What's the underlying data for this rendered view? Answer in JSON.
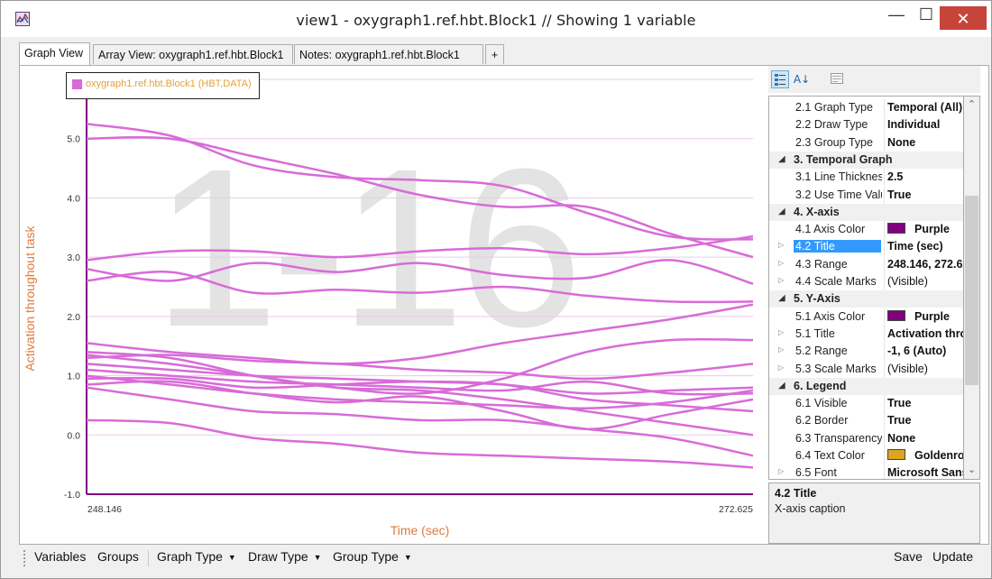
{
  "window": {
    "title": "view1 - oxygraph1.ref.hbt.Block1 // Showing 1 variable",
    "minimize_glyph": "—",
    "maximize_glyph": "☐",
    "close_glyph": "✕"
  },
  "tabs": [
    {
      "label": "Graph View",
      "active": true
    },
    {
      "label": "Array View: oxygraph1.ref.hbt.Block1",
      "active": false
    },
    {
      "label": "Notes: oxygraph1.ref.hbt.Block1",
      "active": false
    },
    {
      "label": "+",
      "active": false
    }
  ],
  "watermark": "1-16",
  "legend": {
    "label": "oxygraph1.ref.hbt.Block1 (HBT,DATA)",
    "swatch_color": "#d86bd8",
    "text_color": "#e3a23a"
  },
  "chart_data": {
    "type": "line",
    "xlabel": "Time (sec)",
    "ylabel": "Activation throughout task",
    "xlim": [
      248.146,
      272.625
    ],
    "ylim": [
      -1.0,
      6.0
    ],
    "x_tick_labels": [
      "248.146",
      "272.625"
    ],
    "y_ticks": [
      "-1.0",
      "0.0",
      "1.0",
      "2.0",
      "3.0",
      "4.0",
      "5.0",
      "6.0"
    ],
    "line_color": "#d86bd8",
    "axis_color": "#800080",
    "label_color": "#e07a3a",
    "grid": true,
    "x": [
      248.146,
      251.206,
      254.266,
      257.326,
      260.386,
      263.446,
      266.506,
      269.566,
      272.625
    ],
    "series": [
      {
        "values": [
          5.25,
          5.05,
          4.55,
          4.35,
          4.3,
          4.2,
          3.75,
          3.35,
          3.3
        ]
      },
      {
        "values": [
          5.0,
          5.0,
          4.7,
          4.4,
          4.05,
          3.85,
          3.85,
          3.4,
          3.0
        ]
      },
      {
        "values": [
          2.95,
          3.1,
          3.1,
          3.0,
          3.1,
          3.15,
          3.05,
          3.15,
          3.35
        ]
      },
      {
        "values": [
          2.8,
          2.6,
          2.9,
          2.75,
          2.9,
          2.7,
          2.65,
          2.95,
          2.55
        ]
      },
      {
        "values": [
          2.6,
          2.75,
          2.4,
          2.45,
          2.4,
          2.5,
          2.35,
          2.25,
          2.25
        ]
      },
      {
        "values": [
          1.55,
          1.4,
          1.3,
          1.2,
          1.3,
          1.55,
          1.75,
          1.95,
          2.2
        ]
      },
      {
        "values": [
          1.35,
          1.2,
          1.0,
          0.8,
          0.7,
          0.95,
          1.4,
          1.6,
          1.6
        ]
      },
      {
        "values": [
          1.3,
          1.35,
          1.25,
          1.2,
          1.1,
          1.05,
          0.95,
          1.05,
          1.2
        ]
      },
      {
        "values": [
          1.2,
          1.1,
          1.0,
          0.95,
          0.9,
          0.85,
          0.7,
          0.75,
          0.8
        ]
      },
      {
        "values": [
          1.1,
          1.0,
          0.9,
          0.85,
          0.8,
          0.75,
          0.9,
          0.7,
          0.7
        ]
      },
      {
        "values": [
          0.95,
          0.95,
          0.8,
          0.85,
          0.9,
          0.85,
          0.6,
          0.5,
          0.4
        ]
      },
      {
        "values": [
          1.4,
          1.3,
          1.0,
          0.8,
          0.75,
          0.6,
          0.4,
          0.2,
          0.0
        ]
      },
      {
        "values": [
          0.85,
          0.9,
          0.7,
          0.55,
          0.65,
          0.4,
          0.1,
          0.35,
          0.6
        ]
      },
      {
        "values": [
          0.8,
          0.6,
          0.4,
          0.35,
          0.25,
          0.25,
          0.1,
          -0.05,
          -0.35
        ]
      },
      {
        "values": [
          0.25,
          0.2,
          -0.05,
          -0.15,
          -0.3,
          -0.35,
          -0.4,
          -0.45,
          -0.55
        ]
      },
      {
        "values": [
          1.0,
          0.85,
          0.7,
          0.6,
          0.55,
          0.5,
          0.45,
          0.55,
          0.75
        ]
      }
    ]
  },
  "property_grid": {
    "toolbar_icons": [
      "categorized-icon",
      "alphabetical-icon",
      "property-pages-icon"
    ],
    "alpha_label": "A↓",
    "rows": [
      {
        "kind": "prop",
        "expand": "",
        "name": "2.1 Graph Type",
        "value": "Temporal (All)",
        "bold": true
      },
      {
        "kind": "prop",
        "expand": "",
        "name": "2.2 Draw Type",
        "value": "Individual",
        "bold": true
      },
      {
        "kind": "prop",
        "expand": "",
        "name": "2.3 Group Type",
        "value": "None",
        "bold": true
      },
      {
        "kind": "cat",
        "name": "3. Temporal Graph"
      },
      {
        "kind": "prop",
        "expand": "",
        "name": "3.1 Line Thickness",
        "value": "2.5",
        "bold": true
      },
      {
        "kind": "prop",
        "expand": "",
        "name": "3.2 Use Time Values",
        "value": "True",
        "bold": true
      },
      {
        "kind": "cat",
        "name": "4. X-axis"
      },
      {
        "kind": "prop",
        "expand": "",
        "name": "4.1 Axis Color",
        "value": "Purple",
        "bold": true,
        "swatch": "#800080"
      },
      {
        "kind": "prop",
        "expand": "▷",
        "name": "4.2 Title",
        "value": "Time (sec)",
        "bold": true,
        "selected": true
      },
      {
        "kind": "prop",
        "expand": "▷",
        "name": "4.3 Range",
        "value": "248.146, 272.625",
        "bold": true
      },
      {
        "kind": "prop",
        "expand": "▷",
        "name": "4.4 Scale Marks",
        "value": "(Visible)",
        "bold": false
      },
      {
        "kind": "cat",
        "name": "5. Y-Axis"
      },
      {
        "kind": "prop",
        "expand": "",
        "name": "5.1 Axis Color",
        "value": "Purple",
        "bold": true,
        "swatch": "#800080"
      },
      {
        "kind": "prop",
        "expand": "▷",
        "name": "5.1 Title",
        "value": "Activation throughout task",
        "bold": true
      },
      {
        "kind": "prop",
        "expand": "▷",
        "name": "5.2 Range",
        "value": "-1, 6 (Auto)",
        "bold": true
      },
      {
        "kind": "prop",
        "expand": "▷",
        "name": "5.3 Scale Marks",
        "value": "(Visible)",
        "bold": false
      },
      {
        "kind": "cat",
        "name": "6. Legend"
      },
      {
        "kind": "prop",
        "expand": "",
        "name": "6.1 Visible",
        "value": "True",
        "bold": true
      },
      {
        "kind": "prop",
        "expand": "",
        "name": "6.2 Border",
        "value": "True",
        "bold": true
      },
      {
        "kind": "prop",
        "expand": "",
        "name": "6.3 Transparency",
        "value": "None",
        "bold": true
      },
      {
        "kind": "prop",
        "expand": "",
        "name": "6.4 Text Color",
        "value": "Goldenrod",
        "bold": true,
        "swatch": "#daa520"
      },
      {
        "kind": "prop",
        "expand": "▷",
        "name": "6.5 Font",
        "value": "Microsoft Sans Serif",
        "bold": true
      }
    ],
    "description": {
      "title": "4.2 Title",
      "text": "X-axis caption"
    }
  },
  "bottombar": {
    "variables": "Variables",
    "groups": "Groups",
    "graph_type": "Graph Type",
    "draw_type": "Draw Type",
    "group_type": "Group Type",
    "save": "Save",
    "update": "Update"
  }
}
